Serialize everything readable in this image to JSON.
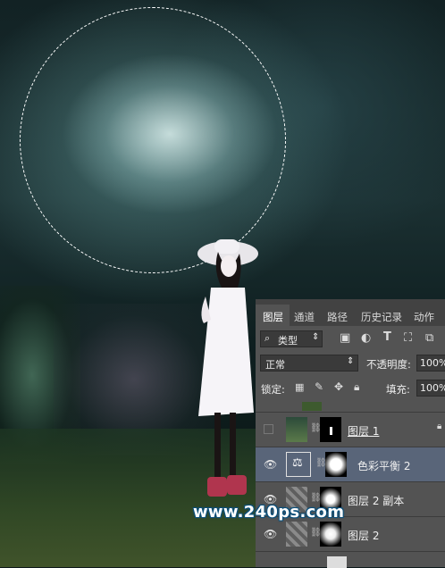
{
  "layers_panel": {
    "tabs": [
      "图层",
      "通道",
      "路径",
      "历史记录",
      "动作"
    ],
    "filter_kind": "类型",
    "blend_mode": "正常",
    "opacity_label": "不透明度:",
    "opacity_value": "100%",
    "lock_label": "锁定:",
    "fill_label": "填充:",
    "fill_value": "100%",
    "layers": [
      {
        "name": "图层 1",
        "visible": false,
        "selected": false
      },
      {
        "name": "色彩平衡 2",
        "visible": true,
        "selected": true
      },
      {
        "name": "图层 2 副本",
        "visible": true,
        "selected": false
      },
      {
        "name": "图层 2",
        "visible": true,
        "selected": false
      }
    ]
  },
  "watermark": "www.240ps.com",
  "colors": {
    "panel_bg": "#535353",
    "selected_layer": "#596579",
    "watermark_outline": "#0b4f7a"
  }
}
